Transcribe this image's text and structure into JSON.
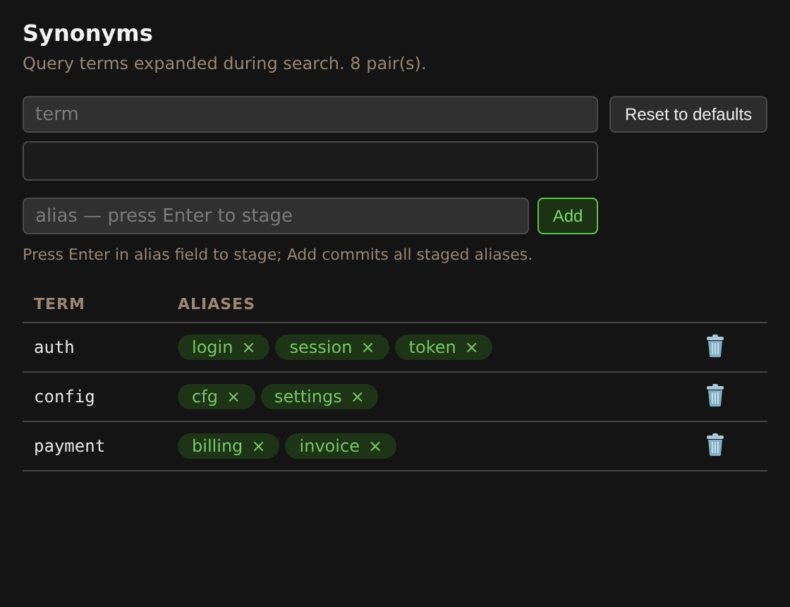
{
  "title": "Synonyms",
  "subtitle": "Query terms expanded during search. 8 pair(s).",
  "term_field": {
    "placeholder": "term"
  },
  "reset_button": "Reset to defaults",
  "second_field": {
    "kind": "input"
  },
  "alias_field": {
    "placeholder": "alias — press Enter to stage"
  },
  "add_button": "Add",
  "hint": "Press Enter in alias field to stage; Add commits all staged aliases.",
  "table": {
    "columns": [
      "TERM",
      "ALIASES"
    ],
    "rows": [
      {
        "term": "auth",
        "aliases": [
          {
            "label": "login",
            "remove": "×"
          },
          {
            "label": "session",
            "remove": "×"
          },
          {
            "label": "token",
            "remove": "×"
          }
        ]
      },
      {
        "term": "config",
        "aliases": [
          {
            "label": "cfg",
            "remove": "×"
          },
          {
            "label": "settings",
            "remove": "×"
          }
        ]
      },
      {
        "term": "payment",
        "aliases": [
          {
            "label": "billing",
            "remove": "×"
          },
          {
            "label": "invoice",
            "remove": "×"
          }
        ]
      }
    ]
  }
}
